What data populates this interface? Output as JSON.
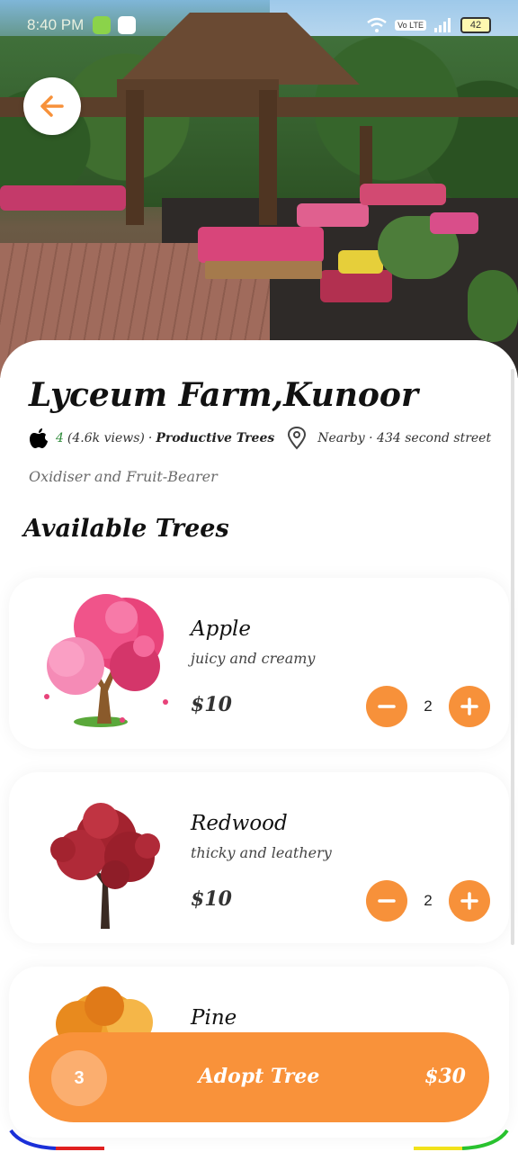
{
  "status_bar": {
    "time": "8:40 PM",
    "network_label": "Vo LTE",
    "battery": "42"
  },
  "farm": {
    "name": "Lyceum Farm,Kunoor",
    "rating": "4",
    "views": "(4.6k views)",
    "category": "Productive Trees",
    "location": "Nearby · 434 second street",
    "tags": "Oxidiser and Fruit-Bearer"
  },
  "section_title": "Available Trees",
  "trees": [
    {
      "name": "Apple",
      "description": "juicy and creamy",
      "price": "$10",
      "quantity": "2"
    },
    {
      "name": "Redwood",
      "description": "thicky and leathery",
      "price": "$10",
      "quantity": "2"
    },
    {
      "name": "Pine",
      "description": "",
      "price": "",
      "quantity": ""
    }
  ],
  "cart": {
    "count": "3",
    "action_label": "Adopt Tree",
    "total": "$30"
  },
  "icons": {
    "back": "arrow-left-icon",
    "brand": "apple-icon",
    "location": "location-pin-icon",
    "minus": "minus-icon",
    "plus": "plus-icon"
  },
  "colors": {
    "accent": "#f7913a",
    "rating_green": "#2e8b3a"
  }
}
